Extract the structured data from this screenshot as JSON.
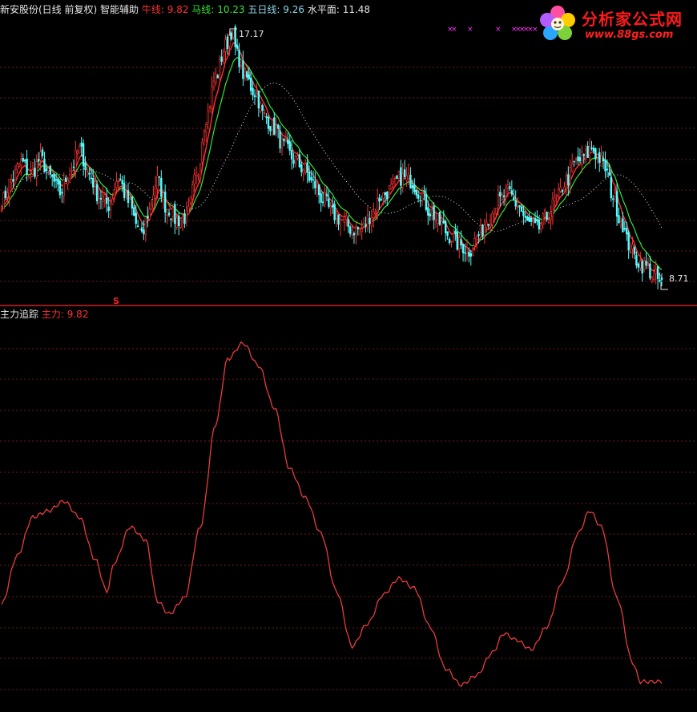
{
  "top_panel": {
    "stock_label": "新安股份(日线 前复权)",
    "indicator_name": "智能辅助",
    "legend": [
      {
        "name": "牛线",
        "value": "9.82",
        "color": "#ff3232"
      },
      {
        "name": "马线",
        "value": "10.23",
        "color": "#32e632"
      },
      {
        "name": "五日线",
        "value": "9.26",
        "color": "#8fd6e8"
      },
      {
        "name": "水平面",
        "value": "11.48",
        "color": "#e6e6e6"
      }
    ],
    "high_annotation": "17.17",
    "low_annotation": "8.71",
    "signal_marker": "S"
  },
  "bottom_panel": {
    "indicator_name": "主力追踪",
    "legend": [
      {
        "name": "主力",
        "value": "9.82",
        "color": "#ff3232"
      }
    ]
  },
  "logo": {
    "brand": "分析家公式网",
    "url": "www.88gs.com"
  },
  "colors": {
    "background": "#000000",
    "up_candle": "#ff3232",
    "down_candle": "#54ffff",
    "niu_line": "#ff3232",
    "ma_line": "#32e632",
    "level_line": "#e6e6e6",
    "main_force_line": "#e83c3c",
    "grid": "#6e1c1c",
    "marker": "#ff33ff"
  },
  "chart_data": [
    {
      "type": "candlestick",
      "title": "智能辅助",
      "price_range": [
        8.71,
        17.17
      ],
      "close_anchors": [
        [
          0,
          11.5
        ],
        [
          5,
          12.2
        ],
        [
          10,
          12.8
        ],
        [
          15,
          12.4
        ],
        [
          20,
          12.9
        ],
        [
          25,
          12.3
        ],
        [
          30,
          11.8
        ],
        [
          35,
          12.5
        ],
        [
          40,
          13.2
        ],
        [
          45,
          12.4
        ],
        [
          50,
          11.7
        ],
        [
          55,
          11.4
        ],
        [
          60,
          12.3
        ],
        [
          65,
          11.5
        ],
        [
          70,
          10.7
        ],
        [
          72,
          10.3
        ],
        [
          75,
          11.1
        ],
        [
          80,
          12.2
        ],
        [
          85,
          11.3
        ],
        [
          90,
          10.9
        ],
        [
          95,
          11.0
        ],
        [
          100,
          12.3
        ],
        [
          105,
          14.3
        ],
        [
          110,
          15.6
        ],
        [
          115,
          16.6
        ],
        [
          118,
          17.1
        ],
        [
          121,
          16.3
        ],
        [
          125,
          15.6
        ],
        [
          130,
          15.1
        ],
        [
          135,
          14.3
        ],
        [
          140,
          13.9
        ],
        [
          145,
          13.3
        ],
        [
          150,
          12.9
        ],
        [
          155,
          12.6
        ],
        [
          160,
          12.1
        ],
        [
          165,
          11.6
        ],
        [
          170,
          11.1
        ],
        [
          175,
          10.9
        ],
        [
          180,
          10.6
        ],
        [
          185,
          10.6
        ],
        [
          190,
          11.1
        ],
        [
          195,
          11.7
        ],
        [
          200,
          11.9
        ],
        [
          205,
          12.3
        ],
        [
          210,
          12.2
        ],
        [
          215,
          11.8
        ],
        [
          220,
          11.2
        ],
        [
          225,
          10.8
        ],
        [
          230,
          10.4
        ],
        [
          235,
          10.1
        ],
        [
          240,
          9.9
        ],
        [
          245,
          10.4
        ],
        [
          250,
          11.0
        ],
        [
          255,
          11.5
        ],
        [
          260,
          11.8
        ],
        [
          265,
          11.4
        ],
        [
          270,
          10.8
        ],
        [
          275,
          10.6
        ],
        [
          280,
          11.0
        ],
        [
          285,
          11.6
        ],
        [
          290,
          12.2
        ],
        [
          295,
          12.8
        ],
        [
          300,
          13.0
        ],
        [
          303,
          13.3
        ],
        [
          306,
          13.0
        ],
        [
          310,
          12.6
        ],
        [
          314,
          11.7
        ],
        [
          318,
          10.9
        ],
        [
          322,
          10.1
        ],
        [
          326,
          9.6
        ],
        [
          330,
          9.4
        ],
        [
          335,
          9.1
        ],
        [
          339,
          8.8
        ]
      ],
      "series": [
        {
          "name": "牛线",
          "value": 9.82
        },
        {
          "name": "马线",
          "value": 10.23
        },
        {
          "name": "五日线",
          "value": 9.26
        },
        {
          "name": "水平面",
          "value": 11.48
        }
      ]
    },
    {
      "type": "line",
      "title": "主力追踪",
      "series": [
        {
          "name": "主力",
          "last_value": 9.82,
          "anchors": [
            [
              0,
              0.16
            ],
            [
              8,
              0.31
            ],
            [
              16,
              0.43
            ],
            [
              24,
              0.45
            ],
            [
              32,
              0.48
            ],
            [
              40,
              0.43
            ],
            [
              48,
              0.3
            ],
            [
              54,
              0.2
            ],
            [
              58,
              0.29
            ],
            [
              66,
              0.4
            ],
            [
              74,
              0.36
            ],
            [
              80,
              0.17
            ],
            [
              86,
              0.13
            ],
            [
              94,
              0.18
            ],
            [
              102,
              0.4
            ],
            [
              110,
              0.72
            ],
            [
              116,
              0.92
            ],
            [
              124,
              0.97
            ],
            [
              132,
              0.9
            ],
            [
              140,
              0.77
            ],
            [
              148,
              0.58
            ],
            [
              156,
              0.49
            ],
            [
              164,
              0.38
            ],
            [
              172,
              0.2
            ],
            [
              180,
              0.03
            ],
            [
              188,
              0.1
            ],
            [
              196,
              0.19
            ],
            [
              204,
              0.24
            ],
            [
              212,
              0.21
            ],
            [
              220,
              0.09
            ],
            [
              228,
              -0.04
            ],
            [
              236,
              -0.09
            ],
            [
              244,
              -0.06
            ],
            [
              252,
              0.01
            ],
            [
              258,
              0.07
            ],
            [
              264,
              0.05
            ],
            [
              272,
              0.02
            ],
            [
              280,
              0.09
            ],
            [
              288,
              0.23
            ],
            [
              296,
              0.38
            ],
            [
              302,
              0.45
            ],
            [
              308,
              0.4
            ],
            [
              316,
              0.18
            ],
            [
              324,
              -0.02
            ],
            [
              328,
              -0.08
            ]
          ]
        }
      ]
    }
  ]
}
